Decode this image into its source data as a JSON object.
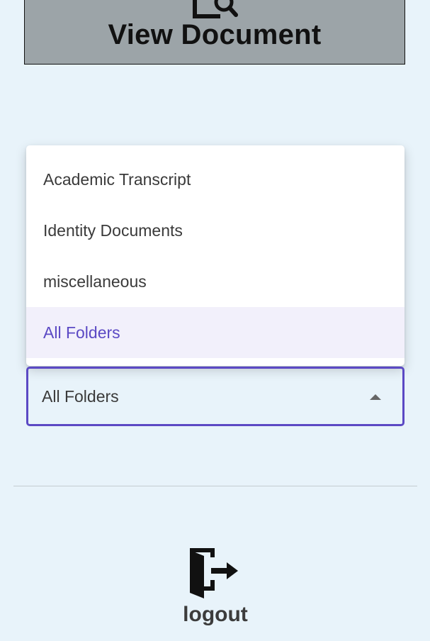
{
  "view_document": {
    "label": "View Document",
    "icon": "document-search-icon"
  },
  "folder_select": {
    "options": [
      "Academic Transcript",
      "Identity Documents",
      "miscellaneous",
      "All Folders"
    ],
    "selected": "All Folders",
    "accent_color": "#5b49c4"
  },
  "logout": {
    "label": "logout",
    "icon": "logout-door-icon"
  },
  "colors": {
    "background": "#e8f3fa",
    "button_bg": "#9ca4a8",
    "selected_bg": "#f2f0fb"
  }
}
